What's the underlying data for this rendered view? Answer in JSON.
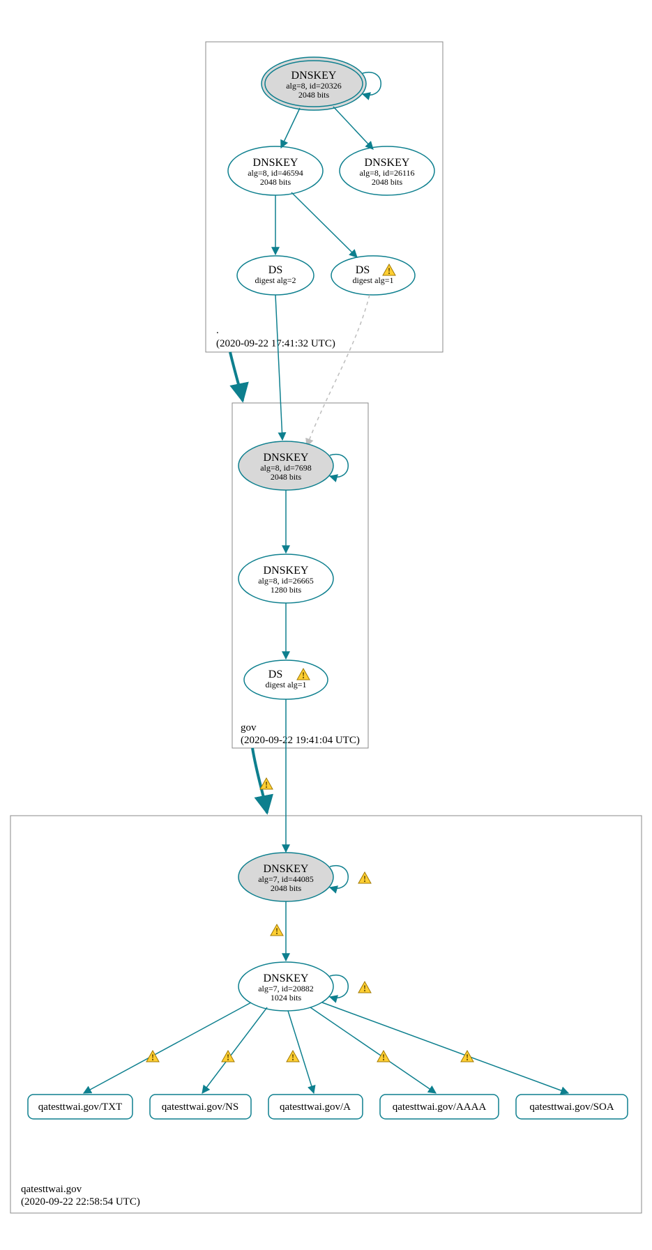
{
  "colors": {
    "accent": "#0d7f8e",
    "node_fill": "#d8d8d8",
    "warning_fill": "#ffcf33",
    "warning_stroke": "#a07800",
    "zone_stroke": "#888888"
  },
  "zones": {
    "root": {
      "label": ".",
      "timestamp": "(2020-09-22 17:41:32 UTC)",
      "nodes": {
        "ksk": {
          "title": "DNSKEY",
          "sub1": "alg=8, id=20326",
          "sub2": "2048 bits"
        },
        "zsk": {
          "title": "DNSKEY",
          "sub1": "alg=8, id=46594",
          "sub2": "2048 bits"
        },
        "standby": {
          "title": "DNSKEY",
          "sub1": "alg=8, id=26116",
          "sub2": "2048 bits"
        },
        "ds2": {
          "title": "DS",
          "sub1": "digest alg=2"
        },
        "ds1": {
          "title": "DS",
          "sub1": "digest alg=1"
        }
      }
    },
    "gov": {
      "label": "gov",
      "timestamp": "(2020-09-22 19:41:04 UTC)",
      "nodes": {
        "ksk": {
          "title": "DNSKEY",
          "sub1": "alg=8, id=7698",
          "sub2": "2048 bits"
        },
        "zsk": {
          "title": "DNSKEY",
          "sub1": "alg=8, id=26665",
          "sub2": "1280 bits"
        },
        "ds": {
          "title": "DS",
          "sub1": "digest alg=1"
        }
      }
    },
    "target": {
      "label": "qatesttwai.gov",
      "timestamp": "(2020-09-22 22:58:54 UTC)",
      "nodes": {
        "ksk": {
          "title": "DNSKEY",
          "sub1": "alg=7, id=44085",
          "sub2": "2048 bits"
        },
        "zsk": {
          "title": "DNSKEY",
          "sub1": "alg=7, id=20882",
          "sub2": "1024 bits"
        }
      },
      "rr": {
        "txt": "qatesttwai.gov/TXT",
        "ns": "qatesttwai.gov/NS",
        "a": "qatesttwai.gov/A",
        "aaaa": "qatesttwai.gov/AAAA",
        "soa": "qatesttwai.gov/SOA"
      }
    }
  }
}
